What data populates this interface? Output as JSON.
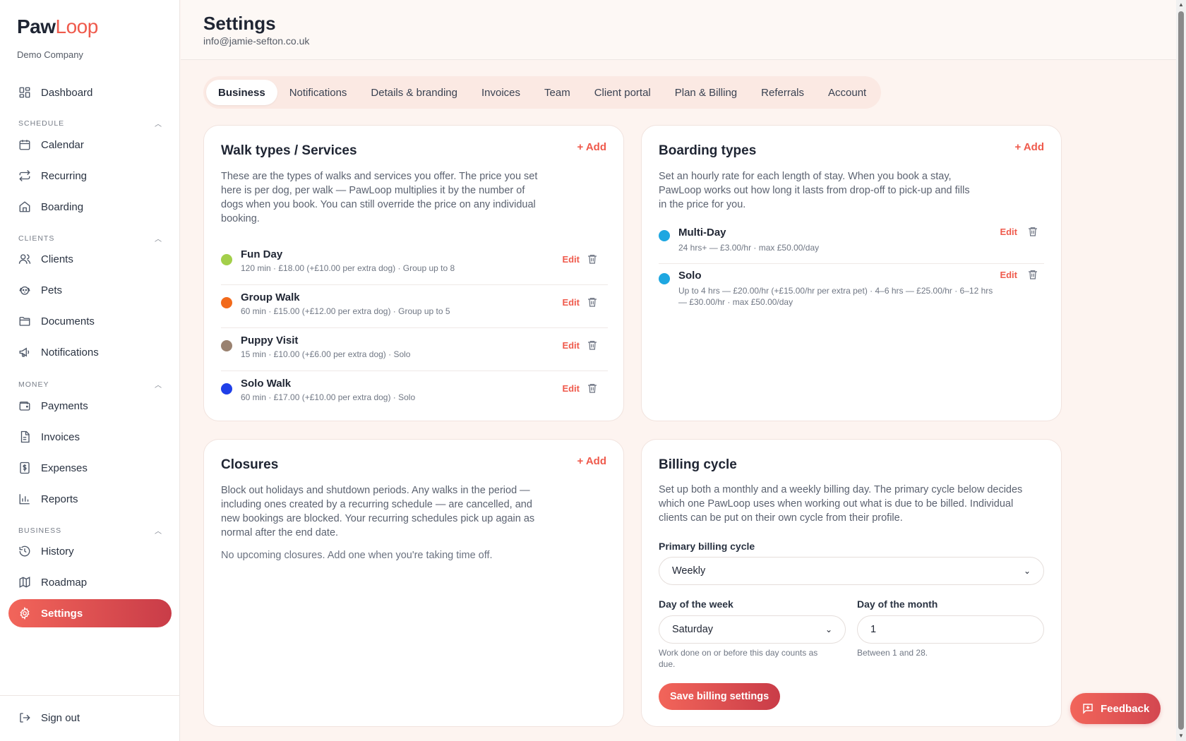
{
  "brand": {
    "name_part1": "Paw",
    "name_part2": "Loop",
    "company": "Demo Company"
  },
  "nav": {
    "dashboard": "Dashboard",
    "schedule_header": "SCHEDULE",
    "calendar": "Calendar",
    "recurring": "Recurring",
    "boarding": "Boarding",
    "clients_header": "CLIENTS",
    "clients": "Clients",
    "pets": "Pets",
    "documents": "Documents",
    "notifications": "Notifications",
    "money_header": "MONEY",
    "payments": "Payments",
    "invoices": "Invoices",
    "expenses": "Expenses",
    "reports": "Reports",
    "business_header": "BUSINESS",
    "history": "History",
    "roadmap": "Roadmap",
    "settings": "Settings",
    "sign_out": "Sign out"
  },
  "header": {
    "title": "Settings",
    "email": "info@jamie-sefton.co.uk"
  },
  "tabs": [
    "Business",
    "Notifications",
    "Details & branding",
    "Invoices",
    "Team",
    "Client portal",
    "Plan & Billing",
    "Referrals",
    "Account"
  ],
  "walk_types": {
    "title": "Walk types / Services",
    "add_label": "+ Add",
    "description": "These are the types of walks and services you offer. The price you set here is per dog, per walk — PawLoop multiplies it by the number of dogs when you book. You can still override the price on any individual booking.",
    "items": [
      {
        "name": "Fun Day",
        "meta": "120 min · £18.00 (+£10.00 per extra dog) · Group up to 8",
        "color": "#a3cf4a",
        "edit": "Edit"
      },
      {
        "name": "Group Walk",
        "meta": "60 min · £15.00 (+£12.00 per extra dog) · Group up to 5",
        "color": "#f26a1b",
        "edit": "Edit"
      },
      {
        "name": "Puppy Visit",
        "meta": "15 min · £10.00 (+£6.00 per extra dog) · Solo",
        "color": "#9a8270",
        "edit": "Edit"
      },
      {
        "name": "Solo Walk",
        "meta": "60 min · £17.00 (+£10.00 per extra dog) · Solo",
        "color": "#1f3fe8",
        "edit": "Edit"
      }
    ]
  },
  "boarding_types": {
    "title": "Boarding types",
    "add_label": "+ Add",
    "description": "Set an hourly rate for each length of stay. When you book a stay, PawLoop works out how long it lasts from drop-off to pick-up and fills in the price for you.",
    "items": [
      {
        "name": "Multi-Day",
        "meta": "24 hrs+ — £3.00/hr · max £50.00/day",
        "color": "#1ea7e1",
        "edit": "Edit"
      },
      {
        "name": "Solo",
        "meta": "Up to 4 hrs — £20.00/hr (+£15.00/hr per extra pet) · 4–6 hrs — £25.00/hr · 6–12 hrs — £30.00/hr · max £50.00/day",
        "color": "#1ea7e1",
        "edit": "Edit"
      }
    ]
  },
  "closures": {
    "title": "Closures",
    "add_label": "+ Add",
    "description": "Block out holidays and shutdown periods. Any walks in the period — including ones created by a recurring schedule — are cancelled, and new bookings are blocked. Your recurring schedules pick up again as normal after the end date.",
    "empty": "No upcoming closures. Add one when you're taking time off."
  },
  "billing": {
    "title": "Billing cycle",
    "description": "Set up both a monthly and a weekly billing day. The primary cycle below decides which one PawLoop uses when working out what is due to be billed. Individual clients can be put on their own cycle from their profile.",
    "primary_label": "Primary billing cycle",
    "primary_value": "Weekly",
    "week_label": "Day of the week",
    "week_value": "Saturday",
    "week_help": "Work done on or before this day counts as due.",
    "month_label": "Day of the month",
    "month_value": "1",
    "month_help": "Between 1 and 28.",
    "save_label": "Save billing settings"
  },
  "feedback_label": "Feedback",
  "colors": {
    "accent": "#ef5a4c",
    "accent_dark": "#c93c48",
    "page_bg": "#fdf4f0"
  }
}
